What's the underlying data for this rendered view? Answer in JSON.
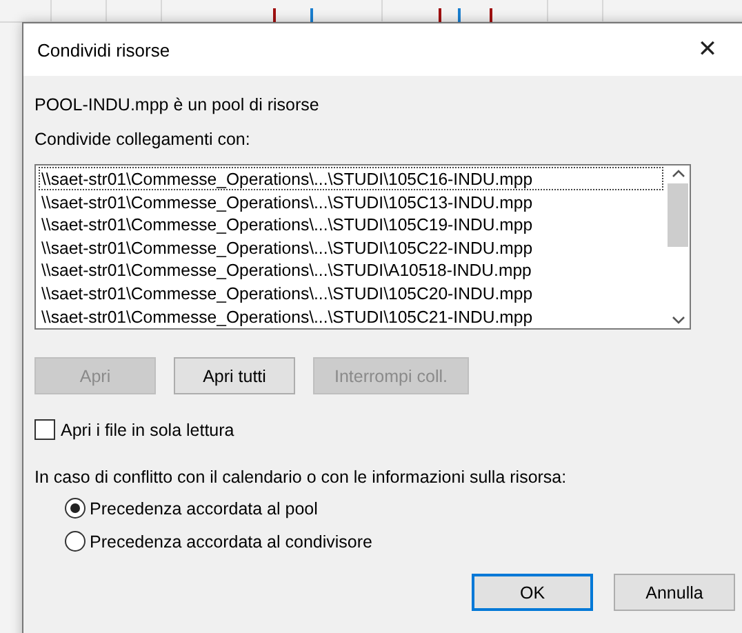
{
  "window": {
    "title": "Condividi risorse",
    "close": "✕"
  },
  "pool_info": "POOL-INDU.mpp è un pool di risorse",
  "links_label": "Condivide collegamenti con:",
  "links": [
    {
      "path": "\\\\saet-str01\\Commesse_Operations\\...\\STUDI\\105C16-INDU.mpp",
      "focused": true
    },
    {
      "path": "\\\\saet-str01\\Commesse_Operations\\...\\STUDI\\105C13-INDU.mpp",
      "focused": false
    },
    {
      "path": "\\\\saet-str01\\Commesse_Operations\\...\\STUDI\\105C19-INDU.mpp",
      "focused": false
    },
    {
      "path": "\\\\saet-str01\\Commesse_Operations\\...\\STUDI\\105C22-INDU.mpp",
      "focused": false
    },
    {
      "path": "\\\\saet-str01\\Commesse_Operations\\...\\STUDI\\A10518-INDU.mpp",
      "focused": false
    },
    {
      "path": "\\\\saet-str01\\Commesse_Operations\\...\\STUDI\\105C20-INDU.mpp",
      "focused": false
    },
    {
      "path": "\\\\saet-str01\\Commesse_Operations\\...\\STUDI\\105C21-INDU.mpp",
      "focused": false
    }
  ],
  "link_buttons": [
    {
      "label": "Apri",
      "disabled": true
    },
    {
      "label": "Apri tutti",
      "disabled": false
    },
    {
      "label": "Interrompi coll.",
      "disabled": true
    }
  ],
  "read_only": {
    "label": "Apri i file in sola lettura",
    "checked": false
  },
  "conflict_label": "In caso di conflitto con il calendario o con le informazioni sulla risorsa:",
  "conflict_options": [
    {
      "label": "Precedenza accordata al pool",
      "selected": true
    },
    {
      "label": "Precedenza accordata al condivisore",
      "selected": false
    }
  ],
  "buttons": [
    {
      "label": "OK",
      "default": true
    },
    {
      "label": "Annulla",
      "default": false
    }
  ]
}
